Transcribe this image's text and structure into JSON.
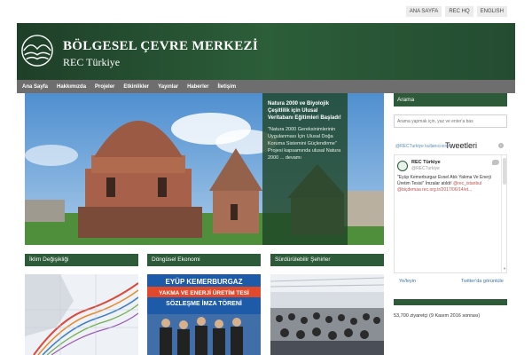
{
  "top_links": [
    "ANA SAYFA",
    "REC HQ",
    "ENGLISH"
  ],
  "brand": {
    "line1": "BÖLGESEL ÇEVRE MERKEZİ",
    "line2": "REC Türkiye"
  },
  "nav": [
    "Ana Sayfa",
    "Hakkımızda",
    "Projeler",
    "Etkinlikler",
    "Yayınlar",
    "Haberler",
    "İletişim"
  ],
  "slide": {
    "title": "Natura 2000 ve Biyolojik Çeşitlilik için Ulusal Veritabanı Eğitimleri Başladı!",
    "body": "\"Natura 2000 Gereksinimlerinin Uygulanması İçin Ulusal Doğa Koruma Sistemini Güçlendirme\" Projesi kapsamında ulusal Natura 2000 ... devamı"
  },
  "sidebar": {
    "search_title": "Arama",
    "search_placeholder": "Arama yapmak için, yaz ve enter'a bas"
  },
  "twitter": {
    "user_line": "@RECTurkiye kullanıcısının",
    "title": "Tweetleri",
    "name": "REC Türkiye",
    "handle": "@RECTurkiye",
    "tweet_text": "\"Eyüp Kemerburgaz Evsel Atık Yakma Ve Enerji Üretim Tesisi\" İmzalar atıldı!",
    "tweet_links": "@rec_istanbul @biçdemaa rec.org.tr/2017/06/14/et...",
    "follow": "Ye/leyin",
    "view": "Twitter'da görüntüle"
  },
  "visitors": "53,700 ziyaretçi (9 Kasım 2016 sonrası)",
  "categories": [
    {
      "label": "İklim Değişikliği"
    },
    {
      "label": "Döngüsel Ekonomi",
      "banner_line1": "EYÜP KEMERBURGAZ",
      "banner_line2": "YAKMA VE ENERJİ ÜRETİM TESİ",
      "banner_line3": "SÖZLEŞME İMZA TÖRENİ"
    },
    {
      "label": "Sürdürülebilir Şehirler"
    }
  ],
  "colors": {
    "brand_green": "#2d5a38",
    "nav_gray": "#6e6e6e",
    "link_blue": "#3b74a8"
  }
}
